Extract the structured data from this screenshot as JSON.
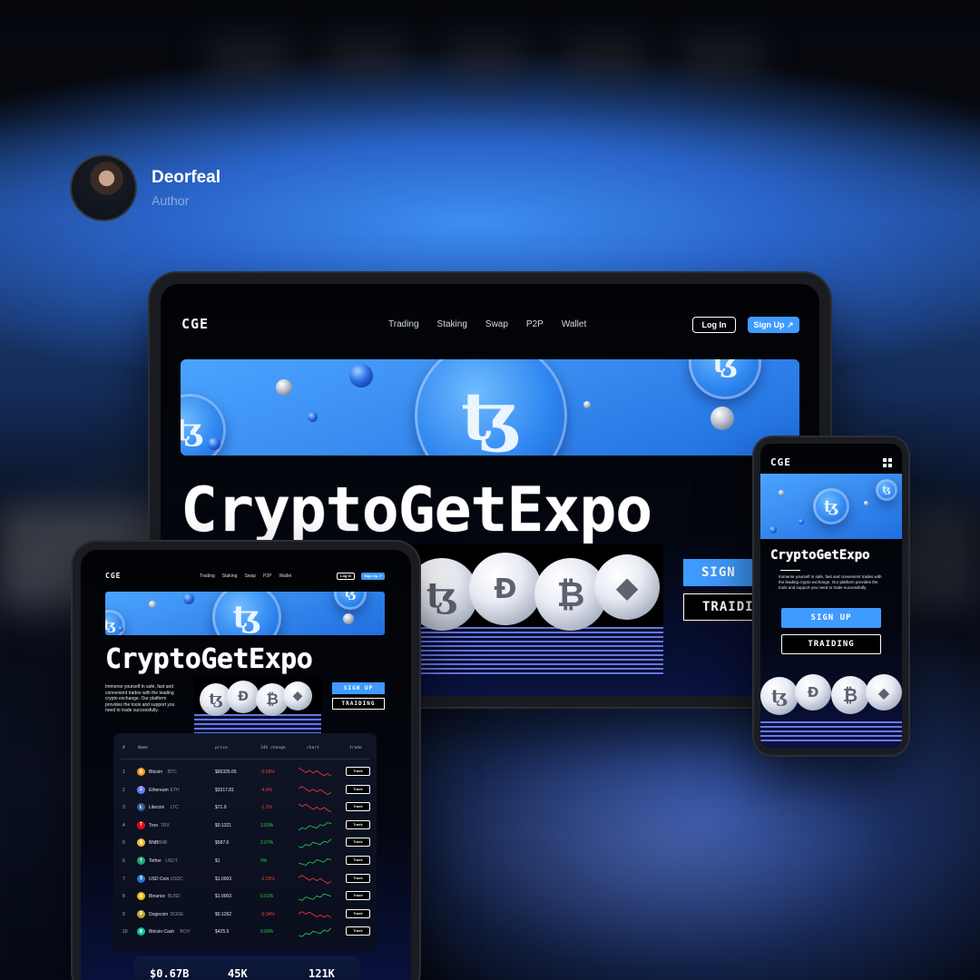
{
  "author": {
    "name": "Deorfeal",
    "role": "Author"
  },
  "site": {
    "logo": "CGE",
    "nav": [
      "Trading",
      "Staking",
      "Swap",
      "P2P",
      "Wallet"
    ],
    "login": "Log In",
    "signup": "Sign Up ↗",
    "headline": "CryptoGetExpo",
    "description": "Immerse yourself in safe, fast and convenient trades with the leading crypto exchange. Our platform provides the tools and support you need to trade successfully.",
    "cta_primary": "SIGN UP",
    "cta_secondary": "TRAIDING",
    "cta_primary_laptop": "SIGN",
    "cta_secondary_laptop": "TRAIDI"
  },
  "icons": {
    "tezos": "tezos-icon",
    "dogecoin": "doge-icon",
    "bitcoin": "bitcoin-icon",
    "ethereum": "ethereum-icon",
    "menu": "grid-menu-icon"
  },
  "colors": {
    "accent": "#3f9bff",
    "negative": "#ff3b3b",
    "positive": "#29d34a"
  },
  "table": {
    "headers": [
      "#",
      "Name",
      "price",
      "24h change",
      "chart",
      "trade"
    ],
    "trade_label": "Trade",
    "rows": [
      {
        "num": "1",
        "name": "Bitcoin",
        "sym": "BTC",
        "price": "$66326.65",
        "change": "-0.58%",
        "dir": "down",
        "color": "#f7931a",
        "glyph": "₿"
      },
      {
        "num": "2",
        "name": "Ethereum",
        "sym": "ETH",
        "price": "$3317.81",
        "change": "-4.0%",
        "dir": "down",
        "color": "#6b7ef2",
        "glyph": "Ξ"
      },
      {
        "num": "3",
        "name": "Litecoin",
        "sym": "LTC",
        "price": "$71.9",
        "change": "-1.2%",
        "dir": "down",
        "color": "#345d9d",
        "glyph": "Ł"
      },
      {
        "num": "4",
        "name": "Tron",
        "sym": "TRX",
        "price": "$0.1321",
        "change": "3.03%",
        "dir": "up",
        "color": "#e50914",
        "glyph": "T"
      },
      {
        "num": "5",
        "name": "BNB",
        "sym": "BNB",
        "price": "$587.6",
        "change": "2.07%",
        "dir": "up",
        "color": "#f3ba2f",
        "glyph": "B"
      },
      {
        "num": "6",
        "name": "Tether",
        "sym": "USDT",
        "price": "$1",
        "change": "0%",
        "dir": "up",
        "color": "#26a17b",
        "glyph": "T"
      },
      {
        "num": "7",
        "name": "USD Coin",
        "sym": "USDC",
        "price": "$1.0003",
        "change": "-2.03%",
        "dir": "down",
        "color": "#2775ca",
        "glyph": "$"
      },
      {
        "num": "8",
        "name": "Binance",
        "sym": "BUSD",
        "price": "$1.0003",
        "change": "0.01%",
        "dir": "up",
        "color": "#f0b90b",
        "glyph": "B"
      },
      {
        "num": "9",
        "name": "Dogecoin",
        "sym": "DOGE",
        "price": "$0.1262",
        "change": "-0.34%",
        "dir": "down",
        "color": "#c2a633",
        "glyph": "Ð"
      },
      {
        "num": "10",
        "name": "Bitcoin Cash",
        "sym": "BCH",
        "price": "$425.5",
        "change": "0.09%",
        "dir": "up",
        "color": "#0ac18e",
        "glyph": "B"
      }
    ]
  },
  "stats": [
    "$0.67B",
    "45K",
    "121K"
  ]
}
